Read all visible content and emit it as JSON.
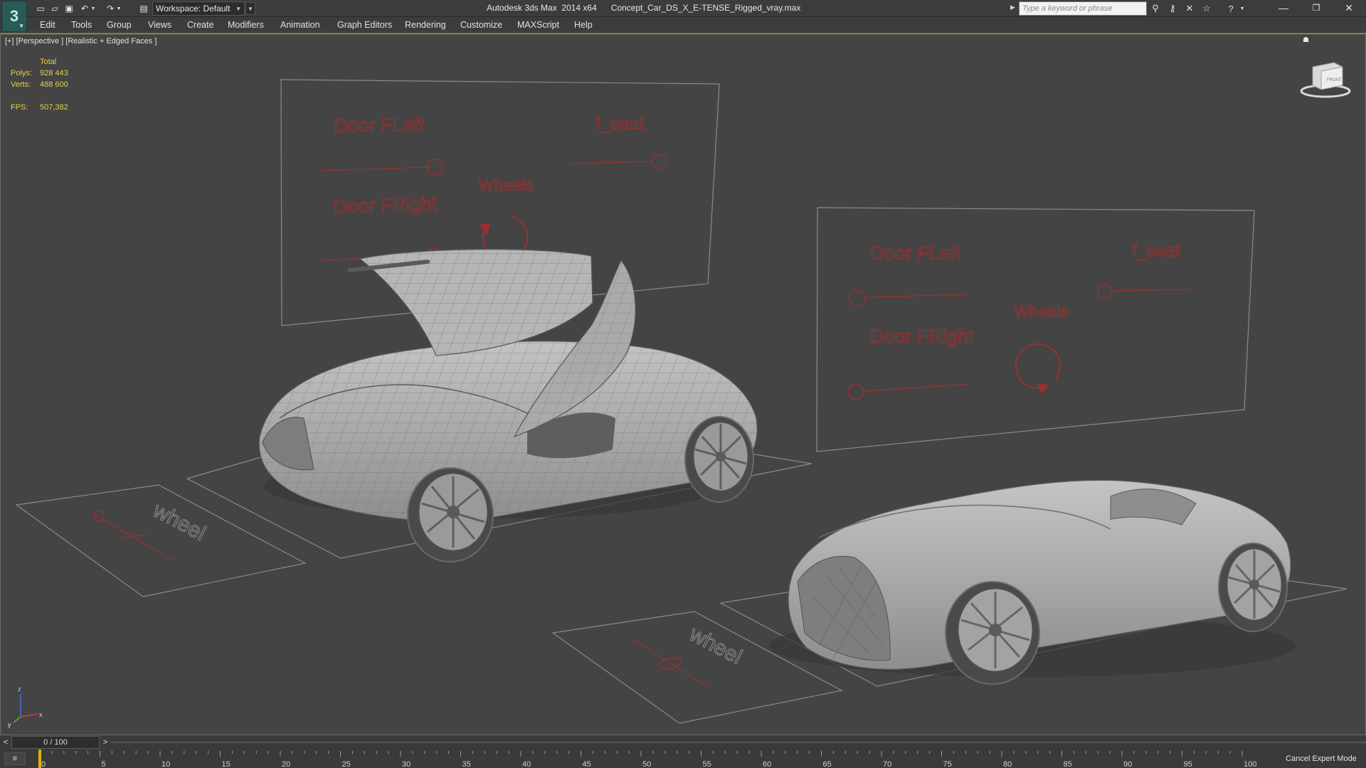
{
  "titlebar": {
    "app_logo": "3",
    "workspace_label": "Workspace: Default",
    "window_title": "Autodesk 3ds Max  2014 x64      Concept_Car_DS_X_E-TENSE_Rigged_vray.max",
    "search_placeholder": "Type a keyword or phrase",
    "icons": {
      "new": "new-file-icon",
      "open": "open-file-icon",
      "save": "save-icon",
      "undo": "undo-icon",
      "redo": "redo-icon",
      "project": "project-folder-icon",
      "binoculars": "binoculars-icon",
      "key": "key-icon",
      "satellite": "satellite-icon",
      "star": "star-icon",
      "help": "help-icon"
    }
  },
  "menubar": {
    "items": [
      "Edit",
      "Tools",
      "Group",
      "Views",
      "Create",
      "Modifiers",
      "Animation",
      "Graph Editors",
      "Rendering",
      "Customize",
      "MAXScript",
      "Help"
    ]
  },
  "viewport": {
    "label": "[+] [Perspective ] [Realistic + Edged Faces ]",
    "stats": {
      "header": "Total",
      "polys_label": "Polys:",
      "polys_value": "928 443",
      "verts_label": "Verts:",
      "verts_value": "488 600",
      "fps_label": "FPS:",
      "fps_value": "507,382"
    },
    "rig_panel_left": {
      "door_fleft": "Door FLeft",
      "f_seat": "f_seat",
      "wheels": "Wheels",
      "door_fright": "Door FRight"
    },
    "rig_panel_right": {
      "door_fleft": "Door FLeft",
      "f_seat": "f_seat",
      "wheels": "Wheels",
      "door_fright": "Door FRight"
    },
    "wheel_control_left": "wheel",
    "wheel_control_right": "wheel",
    "viewcube_face": "FRONT",
    "axis": {
      "x": "x",
      "y": "y",
      "z": "z"
    },
    "colors": {
      "rig_text": "#9e2f2f",
      "stats": "#e8d04a",
      "border_active": "#e8c800"
    }
  },
  "timeline": {
    "frame_display": "0 / 100",
    "prev_label": "<",
    "next_label": ">",
    "ticks": [
      "0",
      "5",
      "10",
      "15",
      "20",
      "25",
      "30",
      "35",
      "40",
      "45",
      "50",
      "55",
      "60",
      "65",
      "70",
      "75",
      "80",
      "85",
      "90",
      "95",
      "100"
    ],
    "expert_mode_button": "Cancel Expert Mode"
  }
}
